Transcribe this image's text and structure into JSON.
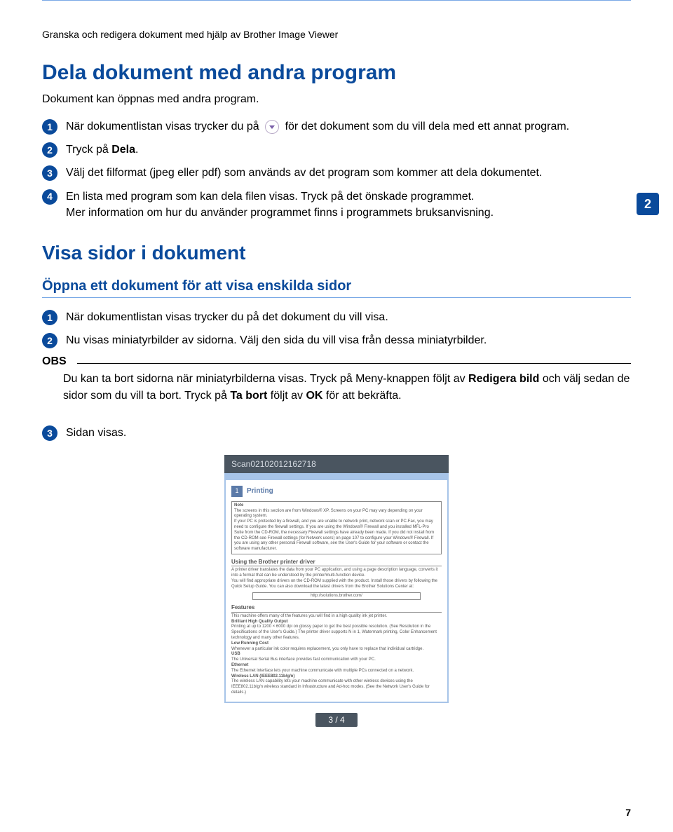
{
  "breadcrumb": "Granska och redigera dokument med hjälp av Brother Image Viewer",
  "side_tab": "2",
  "page_number": "7",
  "section1": {
    "heading": "Dela dokument med andra program",
    "lead": "Dokument kan öppnas med andra program.",
    "steps": {
      "s1": {
        "num": "1",
        "text_before": "När dokumentlistan visas trycker du på ",
        "text_after": " för det dokument som du vill dela med ett annat program."
      },
      "s2": {
        "num": "2",
        "text_before": "Tryck på ",
        "bold": "Dela",
        "text_after": "."
      },
      "s3": {
        "num": "3",
        "text": "Välj det filformat (jpeg eller pdf) som används av det program som kommer att dela dokumentet."
      },
      "s4": {
        "num": "4",
        "line1": "En lista med program som kan dela filen visas. Tryck på det önskade programmet.",
        "line2": "Mer information om hur du använder programmet finns i programmets bruksanvisning."
      }
    }
  },
  "section2": {
    "heading": "Visa sidor i dokument",
    "sub": "Öppna ett dokument för att visa enskilda sidor",
    "steps": {
      "s1": {
        "num": "1",
        "text": "När dokumentlistan visas trycker du på det dokument du vill visa."
      },
      "s2": {
        "num": "2",
        "text": "Nu visas miniatyrbilder av sidorna. Välj den sida du vill visa från dessa miniatyrbilder."
      }
    },
    "note": {
      "label": "OBS",
      "t1": "Du kan ta bort sidorna när miniatyrbilderna visas. Tryck på Meny-knappen följt av ",
      "b1": "Redigera bild",
      "t2": " och välj sedan de sidor som du vill ta bort. Tryck på ",
      "b2": "Ta bort",
      "t3": " följt av ",
      "b3": "OK",
      "t4": " för att bekräfta."
    },
    "step3": {
      "num": "3",
      "text": "Sidan visas."
    }
  },
  "screenshot": {
    "title": "Scan02102012162718",
    "chapter_num": "1",
    "chapter_title": "Printing",
    "note_label": "Note",
    "note_lines": [
      "The screens in this section are from Windows® XP. Screens on your PC may vary depending on your operating system.",
      "If your PC is protected by a firewall, and you are unable to network print, network scan or PC-Fax, you may need to configure the firewall settings. If you are using the Windows® Firewall and you installed MFL-Pro Suite from the CD-ROM, the necessary Firewall settings have already been made. If you did not install from the CD-ROM see Firewall settings (for Network users) on page 107 to configure your Windows® Firewall. If you are using any other personal Firewall software, see the User's Guide for your software or contact the software manufacturer."
    ],
    "h_driver": "Using the Brother printer driver",
    "driver_p1": "A printer driver translates the data from your PC application, and using a page description language, converts it into a format that can be understood by the printer/multi-function device.",
    "driver_p2": "You will find appropriate drivers on the CD-ROM supplied with the product. Install those drivers by following the Quick Setup Guide. You can also download the latest drivers from the Brother Solutions Center at:",
    "url": "http://solutions.brother.com/",
    "h_features": "Features",
    "features": [
      "This machine offers many of the features you will find in a high quality ink jet printer.",
      "Brilliant High Quality Output",
      "Printing at up to 1200 × 6000 dpi on glossy paper to get the best possible resolution. (See Resolution in the Specifications of the User's Guide.) The printer driver supports N in 1, Watermark printing, Color Enhancement technology and many other features.",
      "Low Running Cost",
      "Whenever a particular ink color requires replacement, you only have to replace that individual cartridge.",
      "USB",
      "The Universal Serial Bus interface provides fast communication with your PC.",
      "Ethernet",
      "The Ethernet interface lets your machine communicate with multiple PCs connected on a network.",
      "Wireless LAN (IEEE802.11b/g/n)",
      "The wireless LAN capability lets your machine communicate with other wireless devices using the IEEE802.11b/g/n wireless standard in Infrastructure and Ad-hoc modes. (See the Network User's Guide for details.)"
    ],
    "pager": "3 / 4"
  }
}
